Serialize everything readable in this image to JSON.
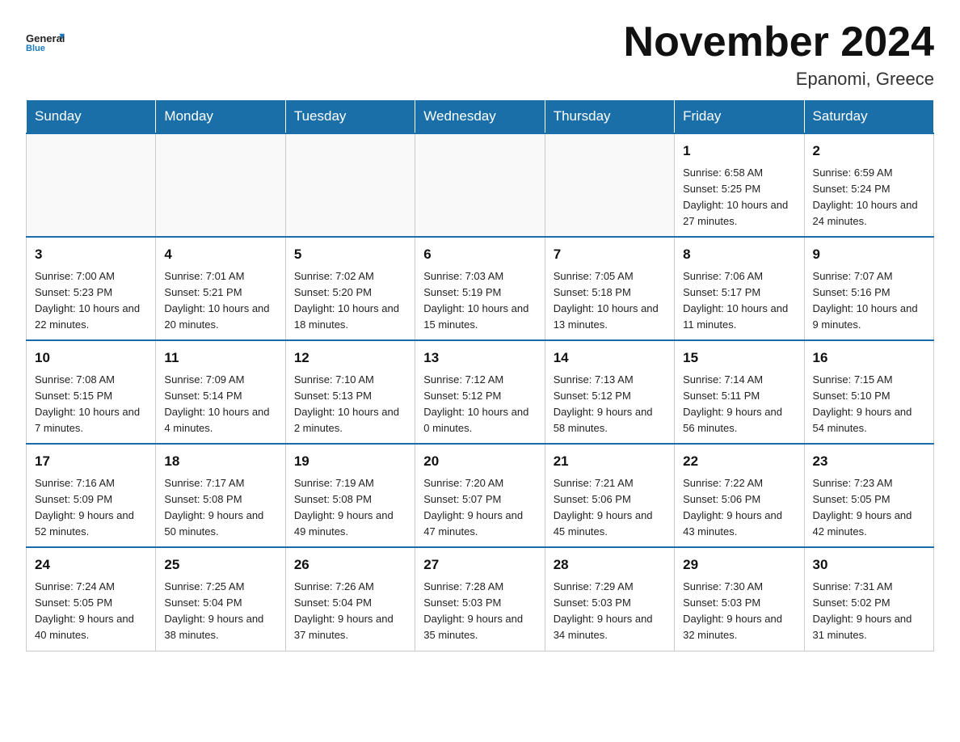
{
  "logo": {
    "text_general": "General",
    "text_blue": "Blue",
    "icon_color": "#1a7abf"
  },
  "header": {
    "month_title": "November 2024",
    "location": "Epanomi, Greece"
  },
  "weekdays": [
    "Sunday",
    "Monday",
    "Tuesday",
    "Wednesday",
    "Thursday",
    "Friday",
    "Saturday"
  ],
  "weeks": [
    {
      "days": [
        {
          "num": "",
          "info": ""
        },
        {
          "num": "",
          "info": ""
        },
        {
          "num": "",
          "info": ""
        },
        {
          "num": "",
          "info": ""
        },
        {
          "num": "",
          "info": ""
        },
        {
          "num": "1",
          "info": "Sunrise: 6:58 AM\nSunset: 5:25 PM\nDaylight: 10 hours and 27 minutes."
        },
        {
          "num": "2",
          "info": "Sunrise: 6:59 AM\nSunset: 5:24 PM\nDaylight: 10 hours and 24 minutes."
        }
      ]
    },
    {
      "days": [
        {
          "num": "3",
          "info": "Sunrise: 7:00 AM\nSunset: 5:23 PM\nDaylight: 10 hours and 22 minutes."
        },
        {
          "num": "4",
          "info": "Sunrise: 7:01 AM\nSunset: 5:21 PM\nDaylight: 10 hours and 20 minutes."
        },
        {
          "num": "5",
          "info": "Sunrise: 7:02 AM\nSunset: 5:20 PM\nDaylight: 10 hours and 18 minutes."
        },
        {
          "num": "6",
          "info": "Sunrise: 7:03 AM\nSunset: 5:19 PM\nDaylight: 10 hours and 15 minutes."
        },
        {
          "num": "7",
          "info": "Sunrise: 7:05 AM\nSunset: 5:18 PM\nDaylight: 10 hours and 13 minutes."
        },
        {
          "num": "8",
          "info": "Sunrise: 7:06 AM\nSunset: 5:17 PM\nDaylight: 10 hours and 11 minutes."
        },
        {
          "num": "9",
          "info": "Sunrise: 7:07 AM\nSunset: 5:16 PM\nDaylight: 10 hours and 9 minutes."
        }
      ]
    },
    {
      "days": [
        {
          "num": "10",
          "info": "Sunrise: 7:08 AM\nSunset: 5:15 PM\nDaylight: 10 hours and 7 minutes."
        },
        {
          "num": "11",
          "info": "Sunrise: 7:09 AM\nSunset: 5:14 PM\nDaylight: 10 hours and 4 minutes."
        },
        {
          "num": "12",
          "info": "Sunrise: 7:10 AM\nSunset: 5:13 PM\nDaylight: 10 hours and 2 minutes."
        },
        {
          "num": "13",
          "info": "Sunrise: 7:12 AM\nSunset: 5:12 PM\nDaylight: 10 hours and 0 minutes."
        },
        {
          "num": "14",
          "info": "Sunrise: 7:13 AM\nSunset: 5:12 PM\nDaylight: 9 hours and 58 minutes."
        },
        {
          "num": "15",
          "info": "Sunrise: 7:14 AM\nSunset: 5:11 PM\nDaylight: 9 hours and 56 minutes."
        },
        {
          "num": "16",
          "info": "Sunrise: 7:15 AM\nSunset: 5:10 PM\nDaylight: 9 hours and 54 minutes."
        }
      ]
    },
    {
      "days": [
        {
          "num": "17",
          "info": "Sunrise: 7:16 AM\nSunset: 5:09 PM\nDaylight: 9 hours and 52 minutes."
        },
        {
          "num": "18",
          "info": "Sunrise: 7:17 AM\nSunset: 5:08 PM\nDaylight: 9 hours and 50 minutes."
        },
        {
          "num": "19",
          "info": "Sunrise: 7:19 AM\nSunset: 5:08 PM\nDaylight: 9 hours and 49 minutes."
        },
        {
          "num": "20",
          "info": "Sunrise: 7:20 AM\nSunset: 5:07 PM\nDaylight: 9 hours and 47 minutes."
        },
        {
          "num": "21",
          "info": "Sunrise: 7:21 AM\nSunset: 5:06 PM\nDaylight: 9 hours and 45 minutes."
        },
        {
          "num": "22",
          "info": "Sunrise: 7:22 AM\nSunset: 5:06 PM\nDaylight: 9 hours and 43 minutes."
        },
        {
          "num": "23",
          "info": "Sunrise: 7:23 AM\nSunset: 5:05 PM\nDaylight: 9 hours and 42 minutes."
        }
      ]
    },
    {
      "days": [
        {
          "num": "24",
          "info": "Sunrise: 7:24 AM\nSunset: 5:05 PM\nDaylight: 9 hours and 40 minutes."
        },
        {
          "num": "25",
          "info": "Sunrise: 7:25 AM\nSunset: 5:04 PM\nDaylight: 9 hours and 38 minutes."
        },
        {
          "num": "26",
          "info": "Sunrise: 7:26 AM\nSunset: 5:04 PM\nDaylight: 9 hours and 37 minutes."
        },
        {
          "num": "27",
          "info": "Sunrise: 7:28 AM\nSunset: 5:03 PM\nDaylight: 9 hours and 35 minutes."
        },
        {
          "num": "28",
          "info": "Sunrise: 7:29 AM\nSunset: 5:03 PM\nDaylight: 9 hours and 34 minutes."
        },
        {
          "num": "29",
          "info": "Sunrise: 7:30 AM\nSunset: 5:03 PM\nDaylight: 9 hours and 32 minutes."
        },
        {
          "num": "30",
          "info": "Sunrise: 7:31 AM\nSunset: 5:02 PM\nDaylight: 9 hours and 31 minutes."
        }
      ]
    }
  ]
}
